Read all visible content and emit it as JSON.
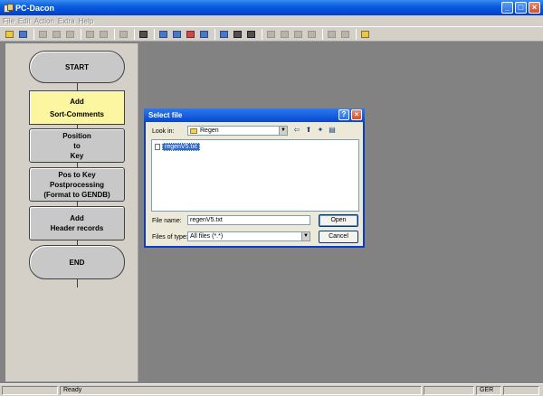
{
  "window": {
    "title": "PC-Dacon"
  },
  "menu": [
    "File",
    "Edit",
    "Action",
    "Extra",
    "Help"
  ],
  "flow": {
    "start": "START",
    "steps": [
      {
        "lines": [
          "Add",
          "Sort-Comments"
        ],
        "active": true
      },
      {
        "lines": [
          "Position",
          "to",
          "Key"
        ],
        "active": false
      },
      {
        "lines": [
          "Pos to Key",
          "Postprocessing",
          "(Format to GENDB)"
        ],
        "active": false
      },
      {
        "lines": [
          "Add",
          "Header records"
        ],
        "active": false
      }
    ],
    "end": "END"
  },
  "dialog": {
    "title": "Select file",
    "look_in_label": "Look in:",
    "look_in_value": "Regen",
    "files": [
      "regenV5.txt"
    ],
    "file_name_label": "File name:",
    "file_name_value": "regenV5.txt",
    "file_type_label": "Files of type:",
    "file_type_value": "All files (*.*)",
    "open_label": "Open",
    "cancel_label": "Cancel"
  },
  "status": {
    "message": "Ready",
    "language": "GER"
  },
  "colors": {
    "active_step": "#fdf6a0",
    "workspace": "#828282",
    "title_bar": "#0a5ee0"
  }
}
